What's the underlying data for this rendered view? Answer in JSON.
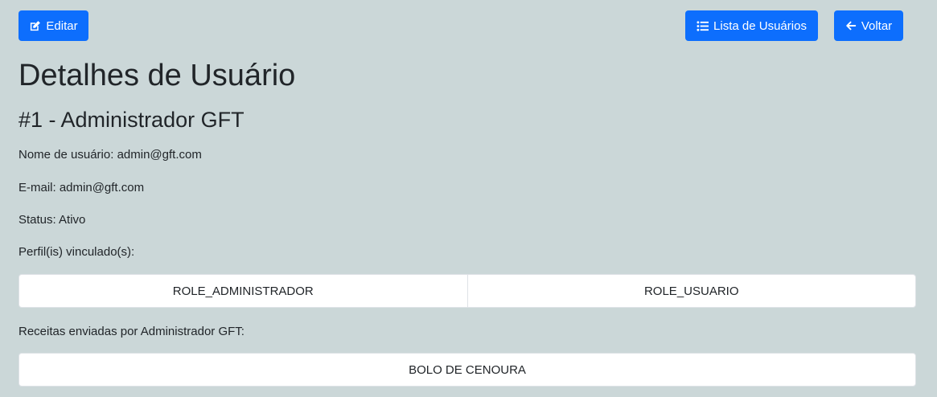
{
  "toolbar": {
    "edit_label": "Editar",
    "list_label": "Lista de Usuários",
    "back_label": "Voltar"
  },
  "page": {
    "title": "Detalhes de Usuário",
    "subtitle": "#1 - Administrador GFT"
  },
  "details": {
    "username": "Nome de usuário: admin@gft.com",
    "email": "E-mail: admin@gft.com",
    "status": "Status: Ativo",
    "profiles_label": "Perfil(is) vinculado(s):"
  },
  "profiles": [
    "ROLE_ADMINISTRADOR",
    "ROLE_USUARIO"
  ],
  "recipes": {
    "label": "Receitas enviadas por Administrador GFT:",
    "items": [
      "BOLO DE CENOURA"
    ]
  },
  "colors": {
    "background": "#cbd7d8",
    "primary": "#0d6efd"
  }
}
